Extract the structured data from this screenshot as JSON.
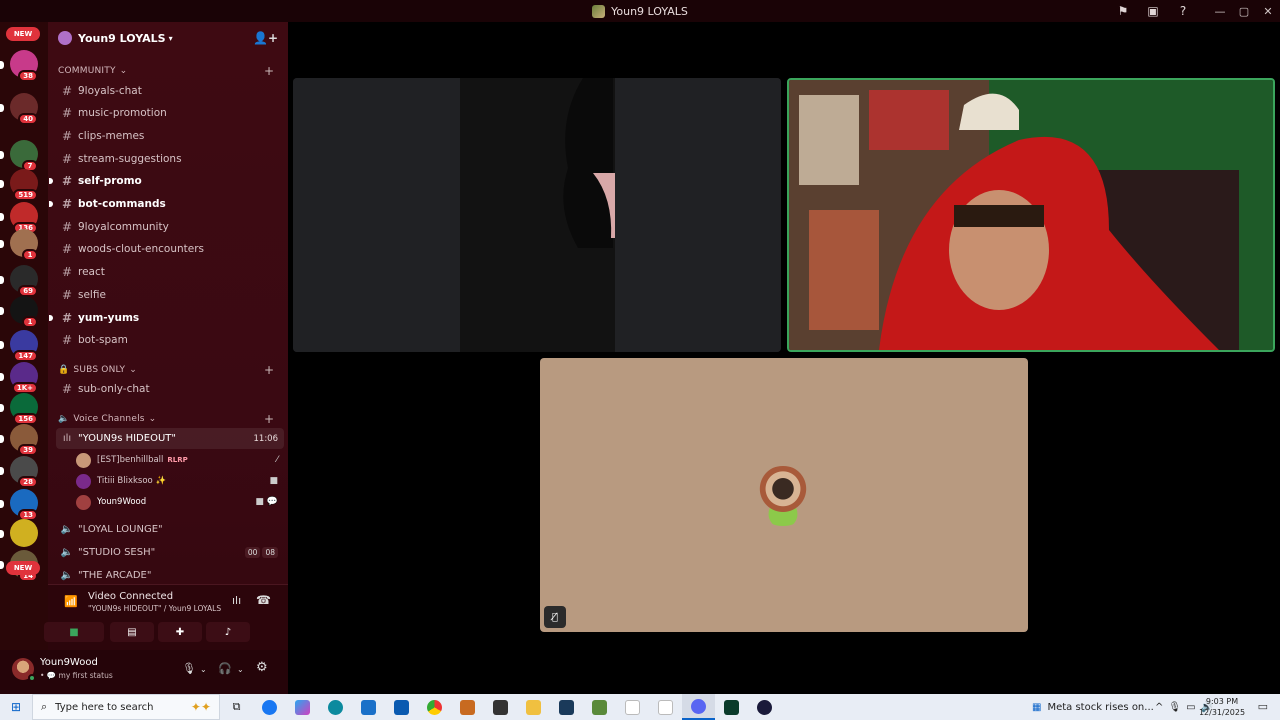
{
  "window": {
    "title": "Youn9 LOYALS",
    "controls": {
      "flag": "flag-icon",
      "screen": "screen-icon",
      "help": "?",
      "minimize": "—",
      "maximize": "▢",
      "close": "✕"
    }
  },
  "rail": {
    "top_label": "NEW",
    "bottom_label": "NEW",
    "servers": [
      {
        "badge": "38",
        "color": "#c83a8a"
      },
      {
        "badge": "40",
        "color": "#6b2a2a"
      },
      {
        "badge": "7",
        "color": "#3a6a3a"
      },
      {
        "badge": "519",
        "color": "#7a1a1a"
      },
      {
        "badge": "136",
        "color": "#c02a2a"
      },
      {
        "badge": "1",
        "color": "#a07050"
      },
      {
        "badge": "69",
        "color": "#2a2a2a"
      },
      {
        "badge": "1",
        "color": "#141414"
      },
      {
        "badge": "147",
        "color": "#3a3aa0"
      },
      {
        "badge": "1K+",
        "color": "#5a2a8a"
      },
      {
        "badge": "156",
        "color": "#0a6a3a"
      },
      {
        "badge": "39",
        "color": "#8a5a3a"
      },
      {
        "badge": "28",
        "color": "#4a4a4a"
      },
      {
        "badge": "13",
        "color": "#1a6ac0"
      },
      {
        "badge": "",
        "color": "#d0b020"
      },
      {
        "badge": "14",
        "color": "#6a5a3a"
      }
    ]
  },
  "server": {
    "name": "Youn9 LOYALS",
    "categories": {
      "community": "COMMUNITY",
      "subs": "SUBS ONLY",
      "voice": "Voice Channels"
    },
    "channels": [
      {
        "name": "9loyals-chat",
        "bold": false
      },
      {
        "name": "music-promotion",
        "bold": false
      },
      {
        "name": "clips-memes",
        "bold": false
      },
      {
        "name": "stream-suggestions",
        "bold": false
      },
      {
        "name": "self-promo",
        "bold": true
      },
      {
        "name": "bot-commands",
        "bold": true
      },
      {
        "name": "9loyalcommunity",
        "bold": false
      },
      {
        "name": "woods-clout-encounters",
        "bold": false
      },
      {
        "name": "react",
        "bold": false
      },
      {
        "name": "selfie",
        "bold": false
      },
      {
        "name": "yum-yums",
        "bold": true
      },
      {
        "name": "bot-spam",
        "bold": false
      }
    ],
    "sub_channel": "sub-only-chat",
    "voice_channels": [
      {
        "name": "\"YOUN9s HIDEOUT\"",
        "timer": "11:06"
      },
      {
        "name": "\"LOYAL LOUNGE\""
      },
      {
        "name": "\"STUDIO SESH\"",
        "counts": [
          "00",
          "08"
        ]
      },
      {
        "name": "\"THE ARCADE\""
      }
    ],
    "voice_users": [
      {
        "name": "[EST]benhillball",
        "tag": "RLRP"
      },
      {
        "name": "Titiii Blixksoo ✨",
        "tag": ""
      },
      {
        "name": "Youn9Wood",
        "tag": ""
      }
    ]
  },
  "voice_panel": {
    "status": "Video Connected",
    "location": "\"YOUN9s HIDEOUT\" / Youn9 LOYALS",
    "buttons": [
      "camera",
      "screen-share",
      "activities",
      "soundboard"
    ]
  },
  "user_panel": {
    "name": "Youn9Wood",
    "status": "my first status"
  },
  "taskbar": {
    "search_placeholder": "Type here to search",
    "news": "Meta stock rises on...",
    "time": "9:03 PM",
    "date": "12/31/2025"
  }
}
